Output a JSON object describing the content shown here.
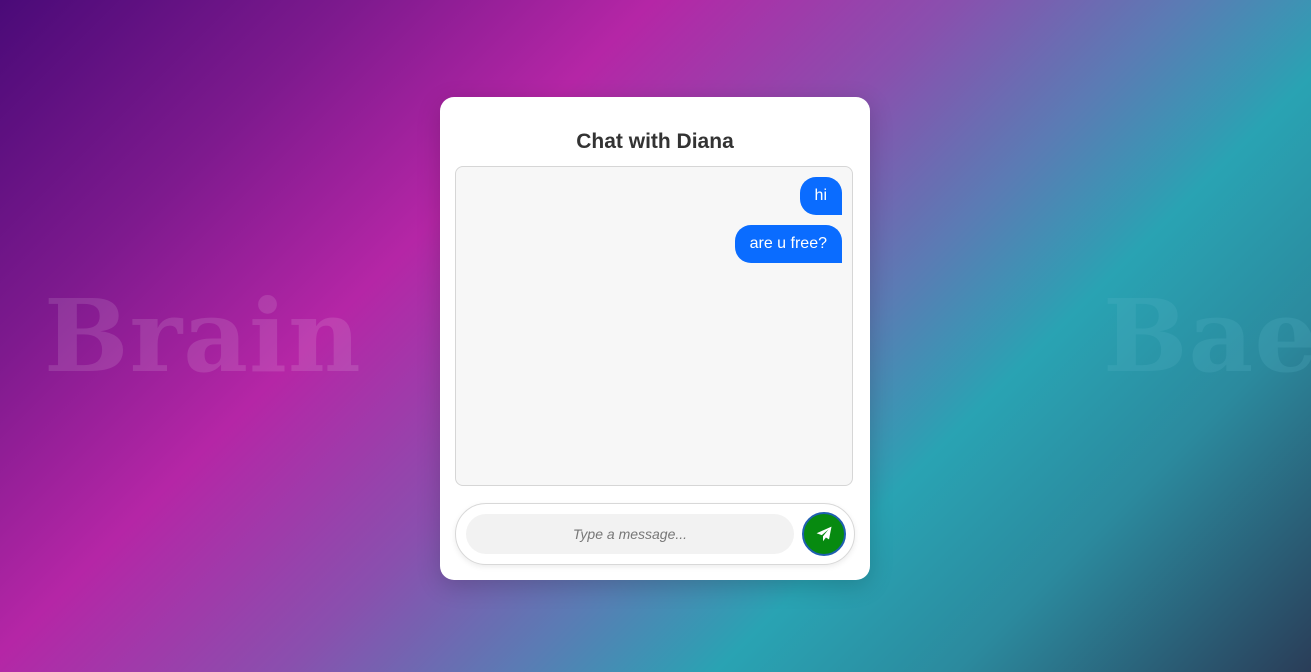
{
  "background": {
    "left_word": "Brain",
    "right_word": "Bae"
  },
  "chat": {
    "title": "Chat with Diana",
    "messages": [
      {
        "text": "hi",
        "sender": "me"
      },
      {
        "text": "are u free?",
        "sender": "me"
      }
    ],
    "input": {
      "value": "",
      "placeholder": "Type a message..."
    },
    "send_icon": "paper-plane-icon",
    "colors": {
      "bubble": "#0a6cff",
      "send_button": "#078a10",
      "card": "#ffffff"
    }
  }
}
